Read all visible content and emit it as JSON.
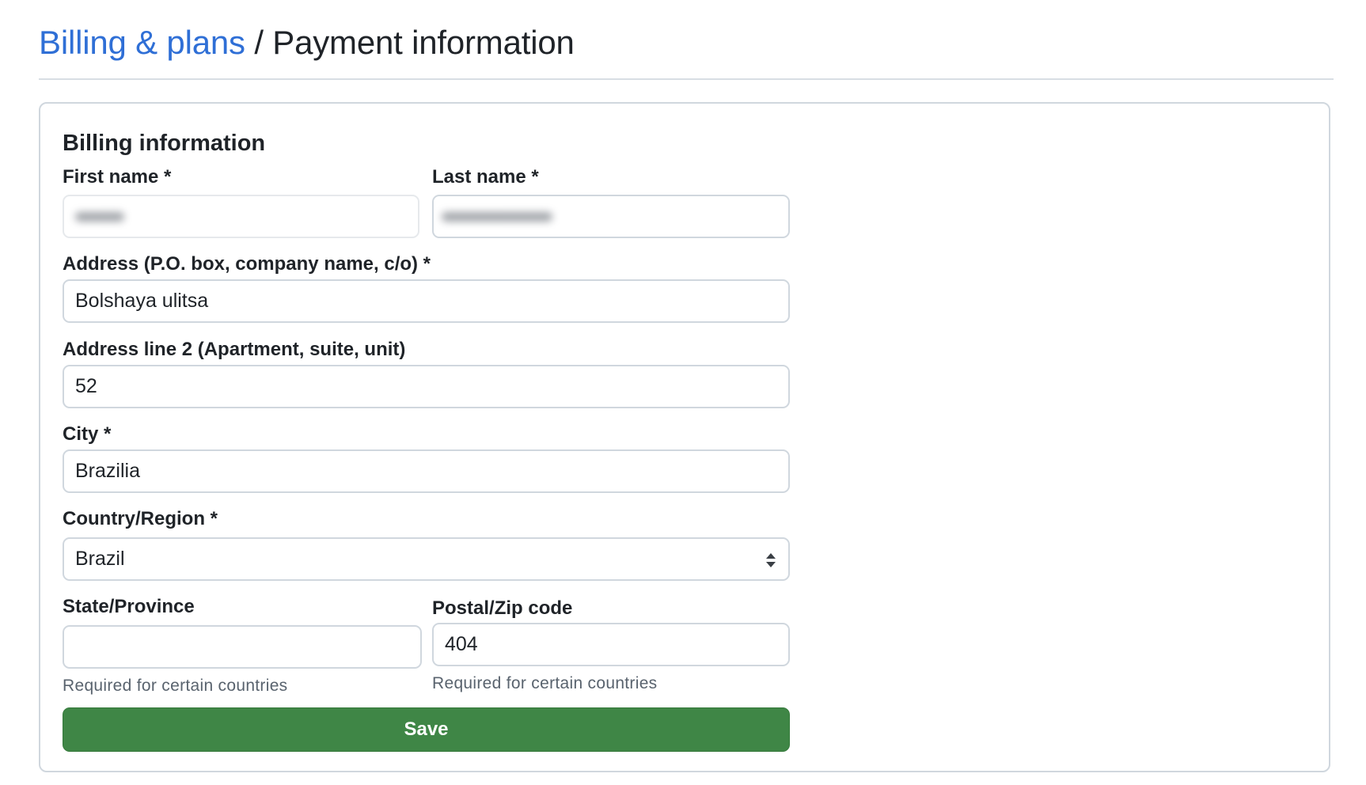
{
  "breadcrumb": {
    "parent": "Billing & plans",
    "separator": "/",
    "current": "Payment information"
  },
  "billing": {
    "title": "Billing information",
    "first_name": {
      "label": "First name *",
      "value": ""
    },
    "last_name": {
      "label": "Last name *",
      "value": ""
    },
    "address": {
      "label": "Address (P.O. box, company name, c/o) *",
      "value": "Bolshaya ulitsa"
    },
    "address2": {
      "label": "Address line 2 (Apartment, suite, unit)",
      "value": "52"
    },
    "city": {
      "label": "City *",
      "value": "Brazilia"
    },
    "country": {
      "label": "Country/Region *",
      "value": "Brazil"
    },
    "state": {
      "label": "State/Province",
      "value": "",
      "hint": "Required for certain countries"
    },
    "postal": {
      "label": "Postal/Zip code",
      "value": "404",
      "hint": "Required for certain countries"
    },
    "save_label": "Save"
  },
  "colors": {
    "link": "#2f6fd6",
    "save_button": "#3f8646",
    "border": "#d0d7de"
  },
  "icons": {
    "select": "select-arrows-icon"
  }
}
